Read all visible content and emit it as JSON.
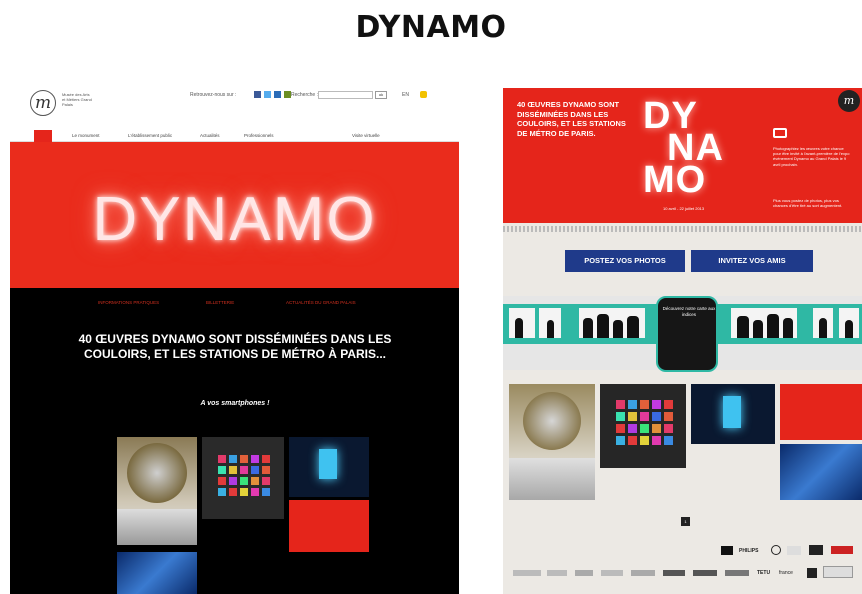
{
  "slide": {
    "title": "DYNAMO"
  },
  "left_site": {
    "header": {
      "logo_letter": "m",
      "logo_text": "Musée des Arts et Métiers Grand Palais",
      "follow_label": "Retrouvez-nous sur :",
      "search_label": "Recherche :",
      "search_button": "ok",
      "util_1": "EN"
    },
    "nav": [
      "Le monument",
      "L'établissement public",
      "Actualités",
      "Professionnels",
      "Visite virtuelle"
    ],
    "banner_text": "DYNAMO",
    "links": [
      "INFORMATIONS PRATIQUES",
      "BILLETTERIE",
      "ACTUALITÉS DU GRAND PALAIS"
    ],
    "headline": "40 ŒUVRES DYNAMO SONT DISSÉMINÉES DANS LES COULOIRS, ET LES STATIONS DE MÉTRO À PARIS...",
    "subline": "A vos smartphones !"
  },
  "right_site": {
    "banner_title": "40 ŒUVRES DYNAMO SONT DISSÉMINÉES DANS LES COULOIRS, ET LES STATIONS DE MÉTRO DE PARIS.",
    "logo_letters": [
      "DY",
      "NA",
      "MO"
    ],
    "dates": "10 avril - 22 juillet 2013",
    "desc_1": "Photographiez les œuvres votre chance pour être invité à l'avant-première de l'expo événement Dynamo au Grand Palais le 9 avril prochain.",
    "desc_2": "Plus vous postez de photos, plus vos chances d'être tiré au sort augmentent.",
    "mlogo": "m",
    "buttons": [
      "POSTEZ VOS PHOTOS",
      "INVITEZ VOS AMIS"
    ],
    "door_text": "Découvrez notre carte aux indices",
    "pager": "1",
    "partners": [
      "PHILIPS",
      "TETU",
      "france"
    ]
  },
  "colors": {
    "brand_red": "#e5251b",
    "metro_green": "#2fb8a4",
    "button_blue": "#1f3a8a"
  }
}
